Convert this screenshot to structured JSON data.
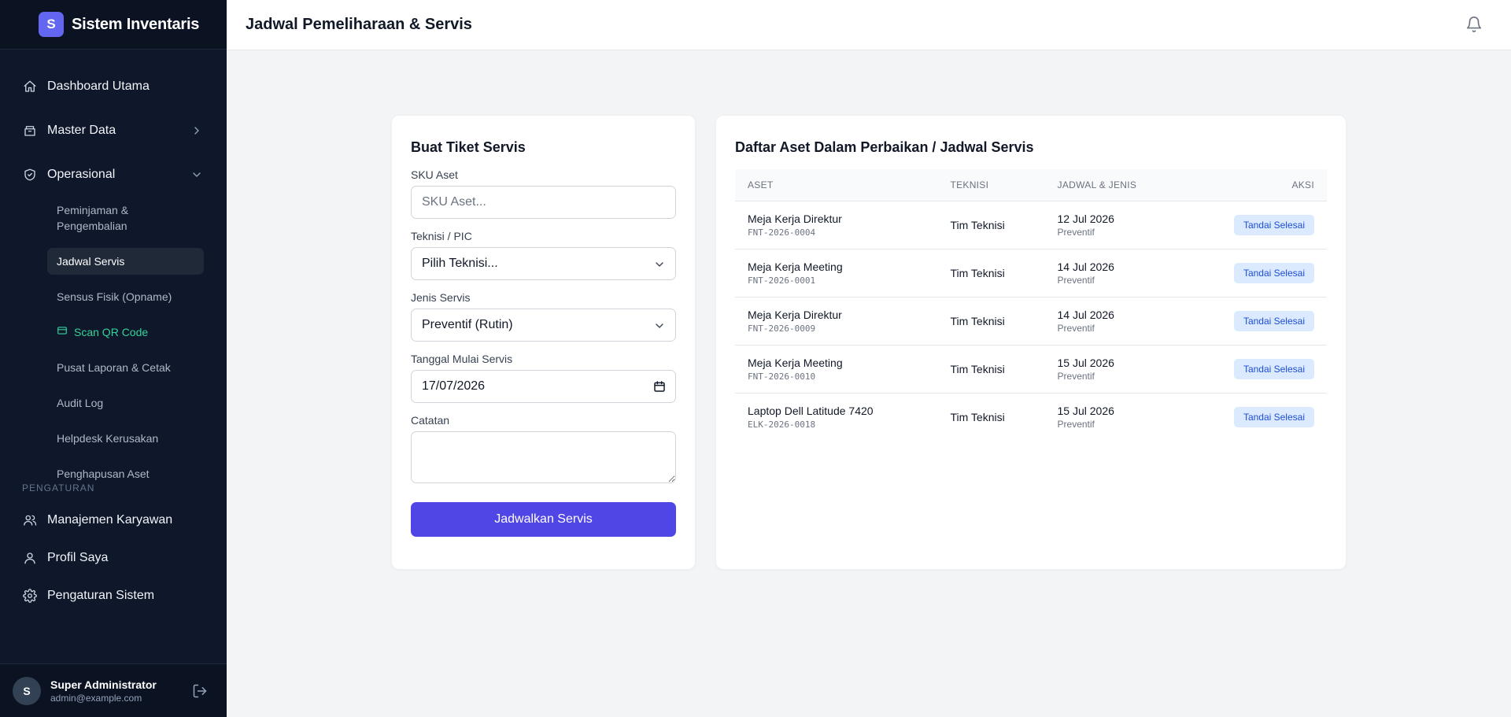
{
  "brand": {
    "logo_letter": "S",
    "title": "Sistem Inventaris"
  },
  "sidebar": {
    "nav_top": [
      {
        "label": "Dashboard Utama",
        "icon": "home-icon"
      },
      {
        "label": "Master Data",
        "icon": "archive-icon"
      },
      {
        "label": "Operasional",
        "icon": "shield-icon"
      }
    ],
    "submenu": [
      {
        "label": "Peminjaman & Pengembalian"
      },
      {
        "label": "Jadwal Servis",
        "active": true
      },
      {
        "label": "Sensus Fisik (Opname)"
      },
      {
        "label": "Scan QR Code"
      },
      {
        "label": "Pusat Laporan & Cetak"
      },
      {
        "label": "Audit Log"
      },
      {
        "label": "Helpdesk Kerusakan"
      },
      {
        "label": "Penghapusan Aset"
      }
    ],
    "section_label": "PENGATURAN",
    "nav_bottom": [
      {
        "label": "Manajemen Karyawan",
        "icon": "users-icon"
      },
      {
        "label": "Profil Saya",
        "icon": "user-icon"
      },
      {
        "label": "Pengaturan Sistem",
        "icon": "gear-icon"
      }
    ]
  },
  "user": {
    "initial": "S",
    "name": "Super Administrator",
    "email": "admin@example.com"
  },
  "header": {
    "title": "Jadwal Pemeliharaan & Servis"
  },
  "form": {
    "title": "Buat Tiket Servis",
    "sku_label": "SKU Aset",
    "sku_placeholder": "SKU Aset...",
    "tech_label": "Teknisi / PIC",
    "tech_value": "Pilih Teknisi...",
    "type_label": "Jenis Servis",
    "type_value": "Preventif (Rutin)",
    "date_label": "Tanggal Mulai Servis",
    "date_value": "17/07/2026",
    "notes_label": "Catatan",
    "submit_label": "Jadwalkan Servis"
  },
  "list": {
    "title": "Daftar Aset Dalam Perbaikan / Jadwal Servis",
    "columns": {
      "asset": "ASET",
      "tech": "TEKNISI",
      "schedule": "JADWAL & JENIS",
      "action": "AKSI"
    },
    "rows": [
      {
        "name": "Meja Kerja Direktur",
        "sku": "FNT-2026-0004",
        "tech": "Tim Teknisi",
        "date": "12 Jul 2026",
        "type": "Preventif",
        "action": "Tandai Selesai"
      },
      {
        "name": "Meja Kerja Meeting",
        "sku": "FNT-2026-0001",
        "tech": "Tim Teknisi",
        "date": "14 Jul 2026",
        "type": "Preventif",
        "action": "Tandai Selesai"
      },
      {
        "name": "Meja Kerja Direktur",
        "sku": "FNT-2026-0009",
        "tech": "Tim Teknisi",
        "date": "14 Jul 2026",
        "type": "Preventif",
        "action": "Tandai Selesai"
      },
      {
        "name": "Meja Kerja Meeting",
        "sku": "FNT-2026-0010",
        "tech": "Tim Teknisi",
        "date": "15 Jul 2026",
        "type": "Preventif",
        "action": "Tandai Selesai"
      },
      {
        "name": "Laptop Dell Latitude 7420",
        "sku": "ELK-2026-0018",
        "tech": "Tim Teknisi",
        "date": "15 Jul 2026",
        "type": "Preventif",
        "action": "Tandai Selesai"
      }
    ]
  },
  "colors": {
    "sidebar_bg": "#0f172a",
    "accent": "#4f46e5",
    "scan_green": "#34d399",
    "done_btn_bg": "#dbeafe",
    "done_btn_text": "#1d4ed8"
  }
}
